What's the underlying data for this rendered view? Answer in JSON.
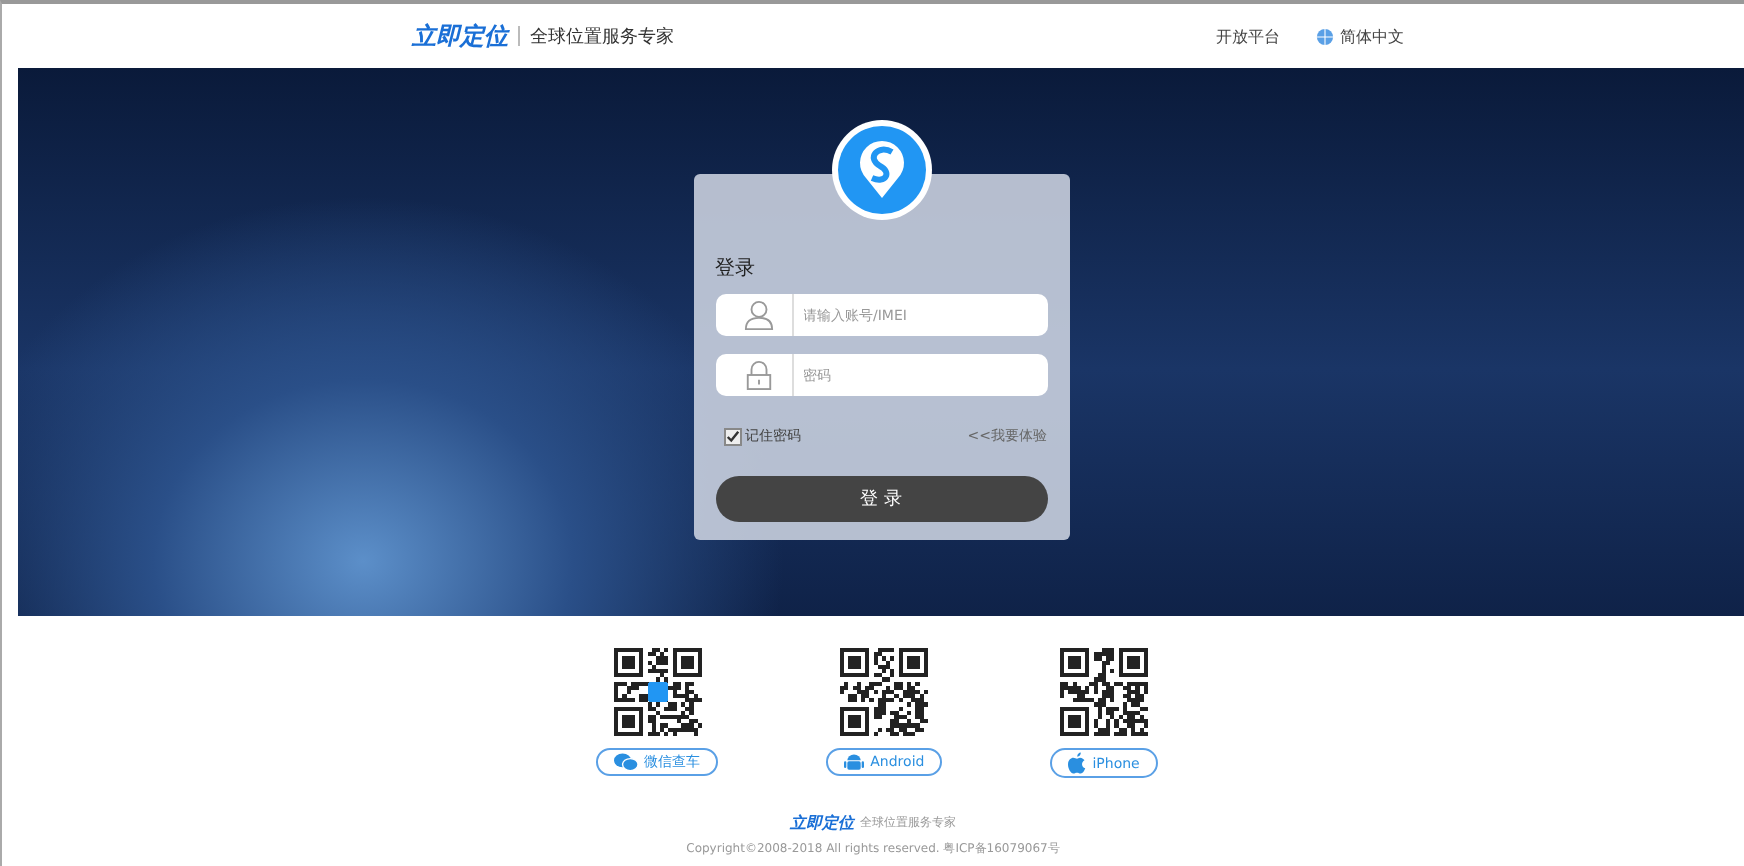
{
  "header": {
    "logo": "立即定位",
    "slogan": "全球位置服务专家",
    "links": [
      {
        "label": "开放平台",
        "kind": "text"
      },
      {
        "label": "简体中文",
        "kind": "globe"
      }
    ]
  },
  "login": {
    "title": "登录",
    "fields": [
      {
        "kind": "user",
        "placeholder": "请输入账号/IMEI"
      },
      {
        "kind": "lock",
        "placeholder": "密码"
      }
    ],
    "remember": {
      "label": "记住密码",
      "checked": true
    },
    "demo_link": "<<我要体验",
    "button": "登 录"
  },
  "downloads": [
    {
      "kind": "wechat",
      "label": "微信查车"
    },
    {
      "kind": "android",
      "label": "Android"
    },
    {
      "kind": "apple",
      "label": "iPhone"
    }
  ],
  "footer": {
    "logo": "立即定位",
    "slogan": "全球位置服务专家",
    "copyright": "Copyright©2008-2018 All rights reserved. 粤ICP备16079067号"
  }
}
